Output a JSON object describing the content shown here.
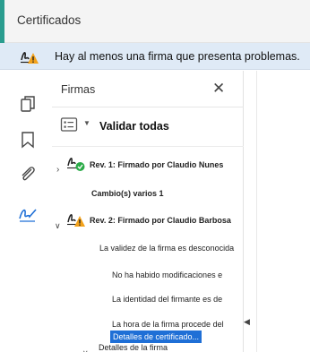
{
  "certificates": {
    "title": "Certificados",
    "accent_color": "#2a9d8f"
  },
  "warning": {
    "icon": "signature-warning-icon",
    "message": "Hay al menos una firma que presenta problemas."
  },
  "rail": {
    "icons": [
      "pages-icon",
      "bookmark-icon",
      "attachment-icon",
      "signature-icon"
    ]
  },
  "panel": {
    "title": "Firmas",
    "validate_all": "Validar todas",
    "rev1": {
      "label": "Rev. 1: Firmado por Claudio Nunes",
      "child": "Cambio(s) varios 1"
    },
    "rev2": {
      "label": "Rev. 2: Firmado por Claudio Barbosa",
      "items": [
        "La validez de la firma es desconocida",
        "No ha habido modificaciones e",
        "La identidad del firmante es de",
        "La hora de la firma procede del"
      ],
      "details": "Detalles de la firma",
      "cert_details": "Detalles de certificado..."
    }
  }
}
